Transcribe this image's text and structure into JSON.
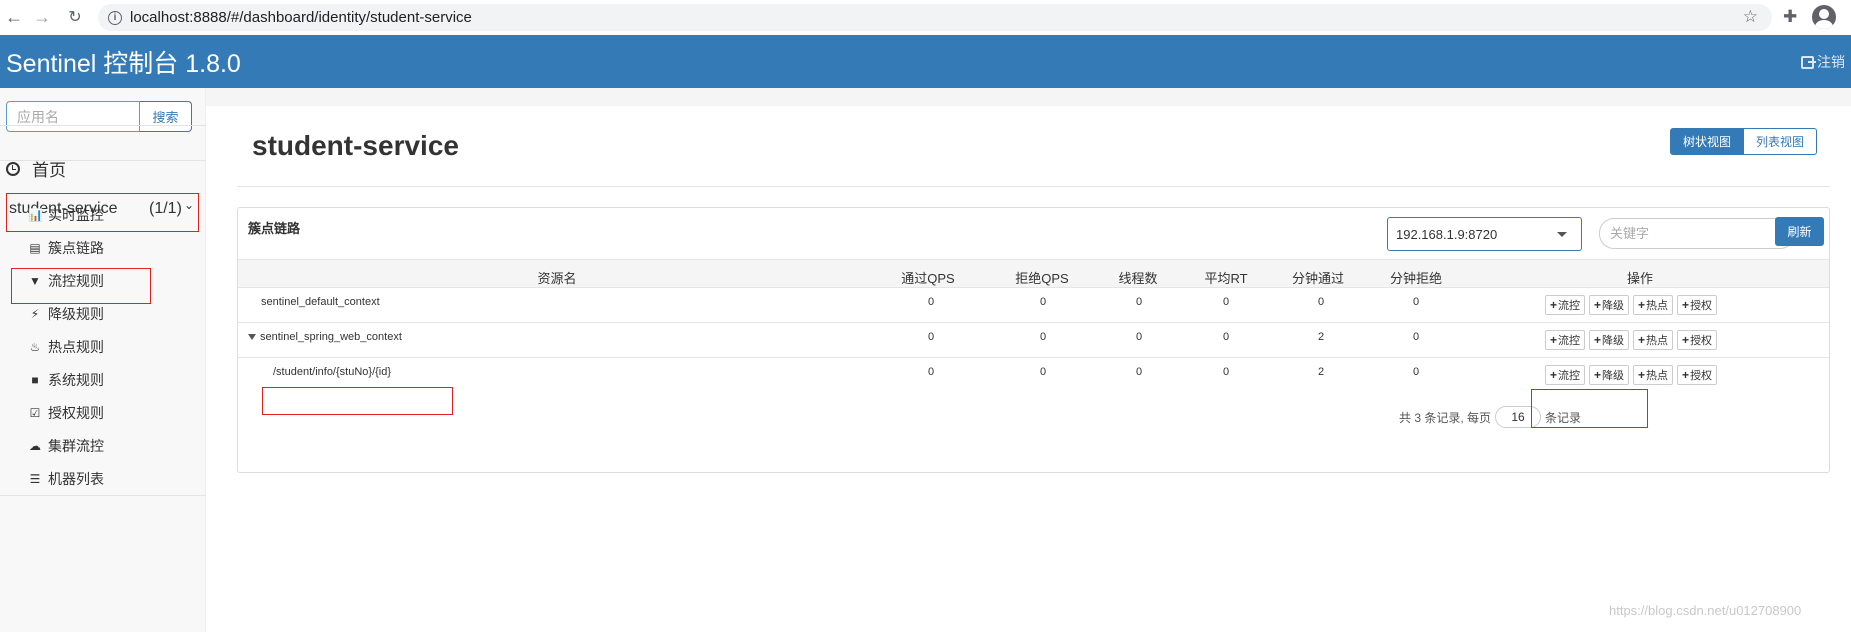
{
  "browser": {
    "url": "localhost:8888/#/dashboard/identity/student-service"
  },
  "header": {
    "title": "Sentinel 控制台 1.8.0",
    "logout_label": "注销"
  },
  "sidebar": {
    "search_placeholder": "应用名",
    "search_button": "搜索",
    "home_label": "首页",
    "app_name": "student-service",
    "app_count": "(1/1)",
    "items": [
      {
        "label": "实时监控",
        "icon": "bar-chart-icon"
      },
      {
        "label": "簇点链路",
        "icon": "list-icon"
      },
      {
        "label": "流控规则",
        "icon": "filter-icon"
      },
      {
        "label": "降级规则",
        "icon": "flash-icon"
      },
      {
        "label": "热点规则",
        "icon": "fire-icon"
      },
      {
        "label": "系统规则",
        "icon": "lock-icon"
      },
      {
        "label": "授权规则",
        "icon": "check-icon"
      },
      {
        "label": "集群流控",
        "icon": "cloud-icon"
      },
      {
        "label": "机器列表",
        "icon": "th-list-icon"
      }
    ]
  },
  "main": {
    "page_title": "student-service",
    "view_tree": "树状视图",
    "view_list": "列表视图",
    "panel_title": "簇点链路",
    "machine": "192.168.1.9:8720",
    "keyword_placeholder": "关键字",
    "refresh_label": "刷新",
    "columns": [
      "资源名",
      "通过QPS",
      "拒绝QPS",
      "线程数",
      "平均RT",
      "分钟通过",
      "分钟拒绝",
      "操作"
    ],
    "rows": [
      {
        "name": "sentinel_default_context",
        "pass_qps": "0",
        "block_qps": "0",
        "threads": "0",
        "avg_rt": "0",
        "min_pass": "0",
        "min_block": "0"
      },
      {
        "name": "sentinel_spring_web_context",
        "pass_qps": "0",
        "block_qps": "0",
        "threads": "0",
        "avg_rt": "0",
        "min_pass": "2",
        "min_block": "0"
      },
      {
        "name": "/student/info/{stuNo}/{id}",
        "pass_qps": "0",
        "block_qps": "0",
        "threads": "0",
        "avg_rt": "0",
        "min_pass": "2",
        "min_block": "0"
      }
    ],
    "ops": [
      "流控",
      "降级",
      "热点",
      "授权"
    ],
    "pager": {
      "prefix": "共 3 条记录, 每页",
      "page_size": "16",
      "suffix": "条记录"
    }
  },
  "watermark": "https://blog.csdn.net/u012708900"
}
